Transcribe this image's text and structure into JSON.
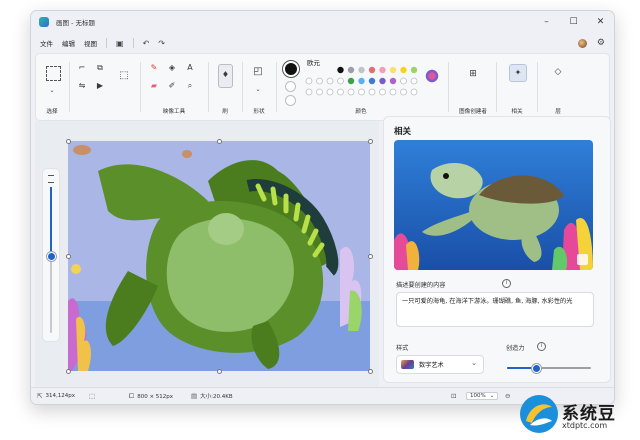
{
  "window": {
    "title": "画图 - 无标题"
  },
  "menu": {
    "file": "文件",
    "edit": "编辑",
    "view": "视图"
  },
  "ribbon": {
    "selection": "选择",
    "image_tools": "映像工具",
    "brush": "刷",
    "shapes": "形状",
    "colors": "颜色",
    "palette": [
      "#111111",
      "#9aa0a6",
      "#c0c4c8",
      "#e07070",
      "#f0a0b8",
      "#f7e26b",
      "#f7d21f",
      "#9bd36b",
      "#3aa04a",
      "#5db0f0",
      "#3c79d8",
      "#7a5ccc",
      "#b061c8"
    ],
    "image_creator": "图像创建者",
    "related": "相关",
    "layers": "层"
  },
  "status": {
    "cursor": "314,124px",
    "canvas_size": "800 × 512px",
    "file_size": "大小:20.4KB",
    "zoom": "100%"
  },
  "panel": {
    "title": "相关",
    "prompt_label": "描述要创建的内容",
    "prompt_text": "一只可爱的海龟, 在海洋下游泳。珊瑚礁, 鱼, 海豚, 水彩性的光",
    "style_label": "样式",
    "style_value": "数字艺术",
    "creativity_label": "创造力",
    "creativity": 0.35
  },
  "watermark": {
    "title": "系统豆",
    "sub": "xtdptc.com"
  },
  "colors": {
    "accent": "#1f64c8",
    "turtle_dark": "#4b7d1e",
    "turtle_light": "#8fbe6a",
    "sky": "#a9b6e6"
  }
}
